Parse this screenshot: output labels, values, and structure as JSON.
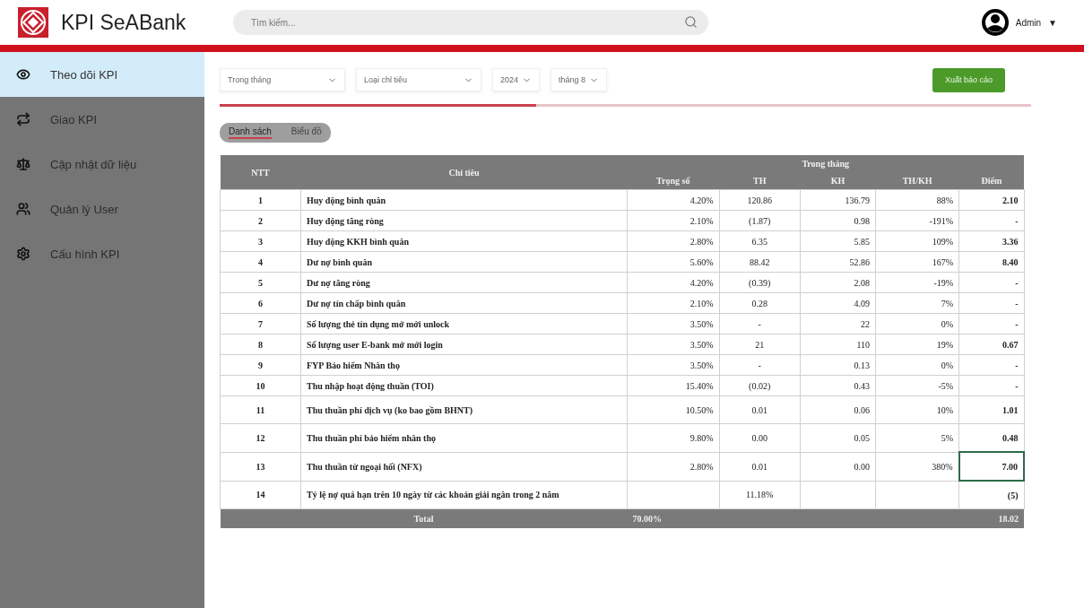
{
  "header": {
    "brand": "KPI SeABank",
    "search": {
      "placeholder": "Tìm kiếm..."
    },
    "user": {
      "name": "Admin",
      "caret": "▼"
    }
  },
  "sidebar": {
    "items": [
      {
        "label": "Theo dõi KPI",
        "selected": true
      },
      {
        "label": "Giao KPI",
        "selected": false
      },
      {
        "label": "Cập nhật dữ liệu",
        "selected": false
      },
      {
        "label": "Quản lý User",
        "selected": false
      },
      {
        "label": "Cấu hình KPI",
        "selected": false
      }
    ]
  },
  "filters": [
    {
      "value": "Trong tháng"
    },
    {
      "value": "Loại chỉ tiêu"
    },
    {
      "value": "2024"
    },
    {
      "value": "tháng 8"
    }
  ],
  "export_button": "Xuất báo cáo",
  "progress": {
    "level": 0.39
  },
  "view_toggle": [
    {
      "label": "Danh sách",
      "selected": true
    },
    {
      "label": "Biểu đồ",
      "selected": false
    }
  ],
  "table": {
    "group_header": "Trong tháng",
    "columns": [
      "NTT",
      "Chỉ tiêu",
      "Trọng số",
      "TH",
      "KH",
      "TH/KH",
      "Điểm"
    ],
    "rows": [
      {
        "cells": [
          "1",
          "Huy động bình quân",
          "4.20%",
          "120.86",
          "136.79",
          "88%",
          "2.10"
        ],
        "selected": false
      },
      {
        "cells": [
          "2",
          "Huy động tăng ròng",
          "2.10%",
          "(1.87)",
          "0.98",
          "-191%",
          "-"
        ],
        "selected": false
      },
      {
        "cells": [
          "3",
          "Huy động KKH bình quân",
          "2.80%",
          "6.35",
          "5.85",
          "109%",
          "3.36"
        ],
        "selected": false
      },
      {
        "cells": [
          "4",
          "Dư nợ bình quân",
          "5.60%",
          "88.42",
          "52.86",
          "167%",
          "8.40"
        ],
        "selected": false
      },
      {
        "cells": [
          "5",
          "Dư nợ tăng ròng",
          "4.20%",
          "(0.39)",
          "2.08",
          "-19%",
          "-"
        ],
        "selected": false
      },
      {
        "cells": [
          "6",
          "Dư nợ tín chấp bình quân",
          "2.10%",
          "0.28",
          "4.09",
          "7%",
          "-"
        ],
        "selected": false
      },
      {
        "cells": [
          "7",
          "Số lượng thẻ tín dụng mở mới unlock",
          "3.50%",
          "-",
          "22",
          "0%",
          "-"
        ],
        "selected": false
      },
      {
        "cells": [
          "8",
          "Số lượng user E-bank mở mới login",
          "3.50%",
          "21",
          "110",
          "19%",
          "0.67"
        ],
        "selected": false
      },
      {
        "cells": [
          "9",
          "FYP Bảo hiểm Nhân thọ",
          "3.50%",
          "-",
          "0.13",
          "0%",
          "-"
        ],
        "selected": false
      },
      {
        "cells": [
          "10",
          "Thu nhập hoạt động thuần (TOI)",
          "15.40%",
          "(0.02)",
          "0.43",
          "-5%",
          "-"
        ],
        "selected": false
      },
      {
        "cells": [
          "11",
          "Thu thuần phí dịch vụ (ko bao gồm BHNT)",
          "10.50%",
          "0.01",
          "0.06",
          "10%",
          "1.01"
        ],
        "selected": false
      },
      {
        "cells": [
          "12",
          "Thu thuần phí bảo hiểm nhân thọ",
          "9.80%",
          "0.00",
          "0.05",
          "5%",
          "0.48"
        ],
        "selected": false
      },
      {
        "cells": [
          "13",
          "Thu thuần từ ngoại hối (NFX)",
          "2.80%",
          "0.01",
          "0.00",
          "380%",
          "7.00"
        ],
        "selected": true
      },
      {
        "cells": [
          "14",
          "Tỷ lệ nợ quá hạn trên 10 ngày từ các khoản giải ngân trong 2 năm",
          "",
          "11.18%",
          "",
          "",
          "(5)"
        ],
        "selected": false
      }
    ],
    "total": {
      "label": "Total",
      "weight": "70.00%",
      "score": "18.02"
    }
  }
}
